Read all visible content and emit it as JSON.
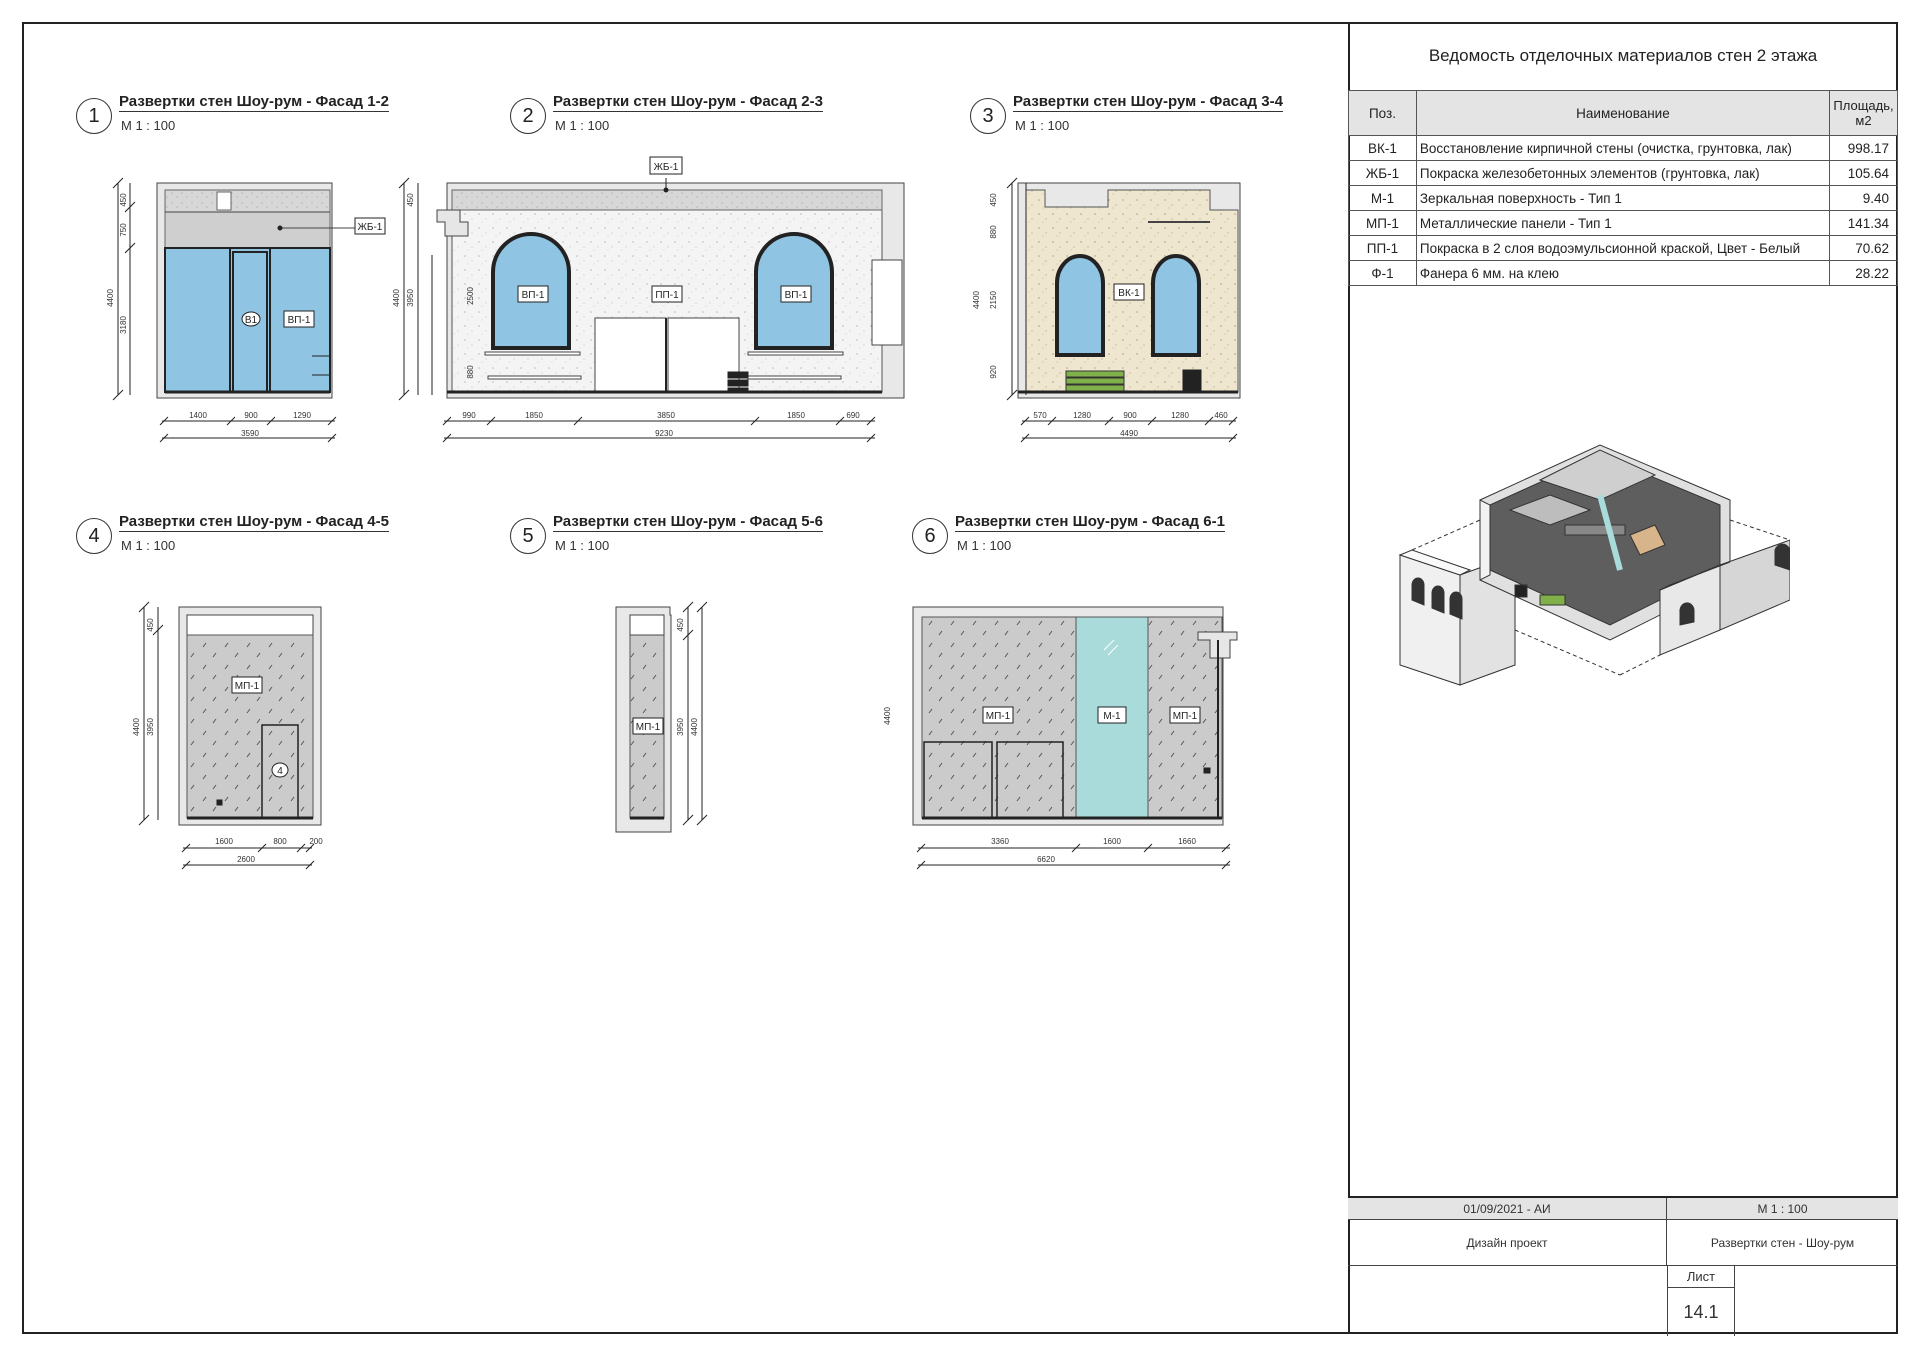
{
  "table": {
    "title": "Ведомость отделочных материалов стен 2 этажа",
    "headers": [
      "Поз.",
      "Наименование",
      "Площадь, м2"
    ],
    "rows": [
      {
        "pos": "ВК-1",
        "name": "Восстановление кирпичной стены (очистка, грунтовка, лак)",
        "area": "998.17"
      },
      {
        "pos": "ЖБ-1",
        "name": "Покраска железобетонных элементов (грунтовка, лак)",
        "area": "105.64"
      },
      {
        "pos": "М-1",
        "name": "Зеркальная поверхность - Тип 1",
        "area": "9.40"
      },
      {
        "pos": "МП-1",
        "name": "Металлические панели - Тип 1",
        "area": "141.34"
      },
      {
        "pos": "ПП-1",
        "name": "Покраска в 2 слоя водоэмульсионной краской, Цвет - Белый",
        "area": "70.62"
      },
      {
        "pos": "Ф-1",
        "name": "Фанера 6 мм. на клею",
        "area": "28.22"
      }
    ]
  },
  "views": [
    {
      "num": "1",
      "title": "Развертки стен Шоу-рум - Фасад 1-2",
      "scale": "М 1 : 100"
    },
    {
      "num": "2",
      "title": "Развертки стен Шоу-рум - Фасад 2-3",
      "scale": "М 1 : 100"
    },
    {
      "num": "3",
      "title": "Развертки стен Шоу-рум - Фасад 3-4",
      "scale": "М 1 : 100"
    },
    {
      "num": "4",
      "title": "Развертки стен Шоу-рум - Фасад 4-5",
      "scale": "М 1 : 100"
    },
    {
      "num": "5",
      "title": "Развертки стен Шоу-рум - Фасад 5-6",
      "scale": "М 1 : 100"
    },
    {
      "num": "6",
      "title": "Развертки стен Шоу-рум - Фасад 6-1",
      "scale": "М 1 : 100"
    }
  ],
  "tags": {
    "v1": {
      "jb": "ЖБ-1",
      "b1": "В1",
      "vp": "ВП-1"
    },
    "v2": {
      "jb": "ЖБ-1",
      "vp_left": "ВП-1",
      "pp": "ПП-1",
      "vp_right": "ВП-1"
    },
    "v3": {
      "vk": "ВК-1"
    },
    "v4": {
      "mp": "МП-1",
      "door": "4"
    },
    "v5": {
      "mp": "МП-1"
    },
    "v6": {
      "mp_left": "МП-1",
      "m": "М-1",
      "mp_right": "МП-1"
    }
  },
  "dims": {
    "v1": {
      "h_total": "4400",
      "h_a": "450",
      "h_b": "750",
      "h_c": "3180",
      "w1": "1400",
      "w2": "900",
      "w3": "1290",
      "w_total": "3590"
    },
    "v2": {
      "h_total": "4400",
      "h_a": "450",
      "h_b": "3950",
      "h_c": "2500",
      "h_d": "880",
      "w1": "990",
      "w2": "1850",
      "w3": "3850",
      "w4": "1850",
      "w5": "690",
      "w_total": "9230"
    },
    "v3": {
      "h_total": "4400",
      "h_a": "450",
      "h_b": "880",
      "h_c": "2150",
      "h_d": "920",
      "w1": "570",
      "w2": "1280",
      "w3": "900",
      "w4": "1280",
      "w5": "460",
      "w_total": "4490"
    },
    "v4": {
      "h_total": "4400",
      "h_a": "450",
      "h_b": "3950",
      "w1": "1600",
      "w2": "800",
      "w3": "200",
      "w_total": "2600"
    },
    "v5": {
      "h_a": "450",
      "h_b": "3950",
      "h_total": "4400"
    },
    "v6": {
      "h_total": "4400",
      "w1": "3360",
      "w2": "1600",
      "w3": "1660",
      "w_total": "6620"
    }
  },
  "stamp": {
    "date": "01/09/2021 - АИ",
    "scale": "М 1 : 100",
    "project": "Дизайн проект",
    "sheet_title": "Развертки стен - Шоу-рум",
    "sheet_label": "Лист",
    "sheet_number": "14.1"
  },
  "colors": {
    "glass": "#8fc4e3",
    "mirror": "#a8dbd9",
    "panel": "#c9c9c9",
    "concrete": "#d5d5d5",
    "brick": "#efe6cf",
    "plaster": "#f3f3f3"
  }
}
